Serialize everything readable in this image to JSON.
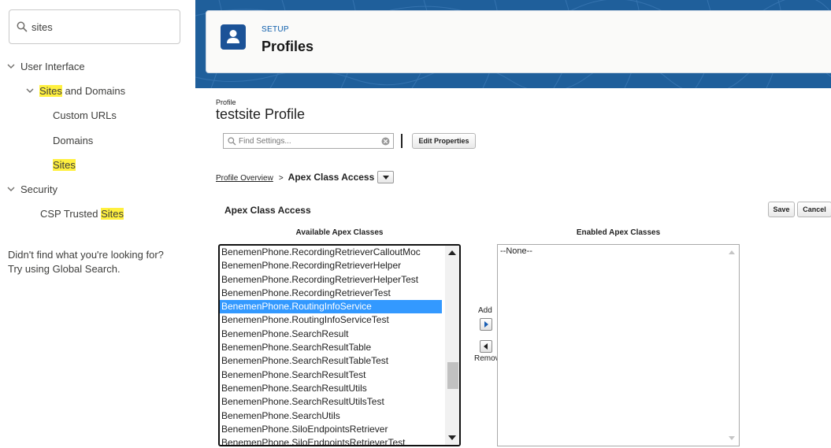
{
  "quick_find": {
    "search_value": "sites",
    "search_prefix": "S",
    "search_highlight": "ites"
  },
  "tree": {
    "user_interface": "User Interface",
    "sites_and_domains_hl": "Sites",
    "sites_and_domains_rest": " and Domains",
    "custom_urls": "Custom URLs",
    "domains": "Domains",
    "sites": "Sites",
    "security": "Security",
    "csp_prefix": "CSP Trusted ",
    "csp_hl": "Sites"
  },
  "help": {
    "line1": "Didn't find what you're looking for?",
    "line2": "Try using Global Search."
  },
  "header": {
    "setup_label": "SETUP",
    "title": "Profiles"
  },
  "profile": {
    "label": "Profile",
    "name": "testsite Profile",
    "find_placeholder": "Find Settings...",
    "edit_properties": "Edit Properties"
  },
  "breadcrumb": {
    "overview": "Profile Overview",
    "separator": ">",
    "current": "Apex Class Access"
  },
  "section": {
    "title": "Apex Class Access",
    "save": "Save",
    "cancel": "Cancel",
    "available_header": "Available Apex Classes",
    "enabled_header": "Enabled Apex Classes",
    "add_label": "Add",
    "remove_label": "Remove",
    "enabled_none": "--None--"
  },
  "available_classes": [
    "BenemenPhone.RecordingRetrieverCalloutMoc",
    "BenemenPhone.RecordingRetrieverHelper",
    "BenemenPhone.RecordingRetrieverHelperTest",
    "BenemenPhone.RecordingRetrieverTest",
    "BenemenPhone.RoutingInfoService",
    "BenemenPhone.RoutingInfoServiceTest",
    "BenemenPhone.SearchResult",
    "BenemenPhone.SearchResultTable",
    "BenemenPhone.SearchResultTableTest",
    "BenemenPhone.SearchResultTest",
    "BenemenPhone.SearchResultUtils",
    "BenemenPhone.SearchResultUtilsTest",
    "BenemenPhone.SearchUtils",
    "BenemenPhone.SiloEndpointsRetriever",
    "BenemenPhone.SiloEndpointsRetrieverTest"
  ],
  "selected_class": "BenemenPhone.RoutingInfoService",
  "colors": {
    "banner": "#1f5f9b",
    "highlight": "#fff03f",
    "selected_row": "#3399ff",
    "setup_label": "#0b5cab",
    "icon_bg": "#1b5297"
  }
}
